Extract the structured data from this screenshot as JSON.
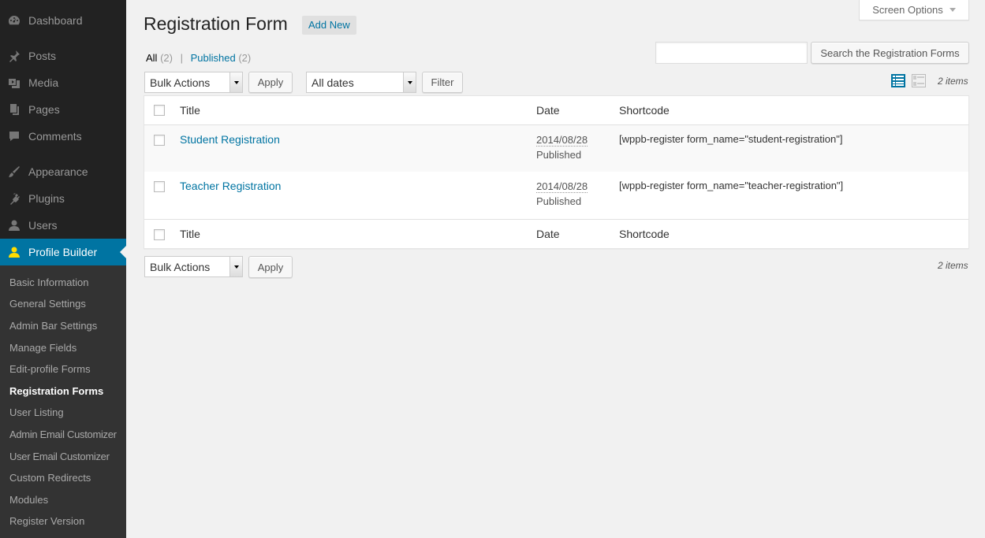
{
  "sidebar": {
    "items": [
      {
        "label": "Dashboard",
        "icon": "dashboard-icon"
      },
      {
        "label": "Posts",
        "icon": "pin-icon"
      },
      {
        "label": "Media",
        "icon": "media-icon"
      },
      {
        "label": "Pages",
        "icon": "pages-icon"
      },
      {
        "label": "Comments",
        "icon": "comment-icon"
      },
      {
        "label": "Appearance",
        "icon": "brush-icon"
      },
      {
        "label": "Plugins",
        "icon": "plug-icon"
      },
      {
        "label": "Users",
        "icon": "user-icon"
      },
      {
        "label": "Profile Builder",
        "icon": "profile-icon"
      }
    ],
    "submenu": [
      "Basic Information",
      "General Settings",
      "Admin Bar Settings",
      "Manage Fields",
      "Edit-profile Forms",
      "Registration Forms",
      "User Listing",
      "Admin Email Customizer",
      "User Email Customizer",
      "Custom Redirects",
      "Modules",
      "Register Version"
    ],
    "active_color": "#0074a2",
    "bg_color": "#222222"
  },
  "header": {
    "title": "Registration Form",
    "add_new": "Add New",
    "screen_options": "Screen Options"
  },
  "filters": {
    "all_label": "All",
    "all_count": "(2)",
    "separator": "|",
    "published_label": "Published",
    "published_count": "(2)"
  },
  "search": {
    "button": "Search the Registration Forms",
    "value": ""
  },
  "toolbar": {
    "bulk_actions": "Bulk Actions",
    "apply": "Apply",
    "dates": "All dates",
    "filter": "Filter",
    "items_count": "2 items"
  },
  "table": {
    "columns": [
      "Title",
      "Date",
      "Shortcode"
    ],
    "rows": [
      {
        "title": "Student Registration",
        "date": "2014/08/28",
        "status": "Published",
        "shortcode": "[wppb-register form_name=\"student-registration\"]"
      },
      {
        "title": "Teacher Registration",
        "date": "2014/08/28",
        "status": "Published",
        "shortcode": "[wppb-register form_name=\"teacher-registration\"]"
      }
    ]
  }
}
